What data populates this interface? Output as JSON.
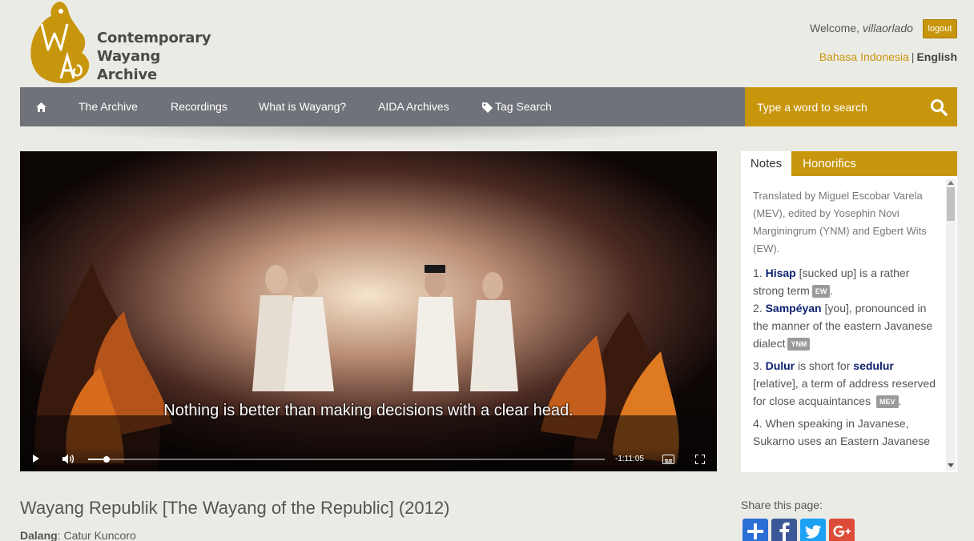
{
  "header": {
    "logo_lines": [
      "Contemporary",
      "Wayang",
      "Archive"
    ],
    "welcome_prefix": "Welcome, ",
    "username": "villaorlado",
    "logout_label": "logout",
    "lang_indonesian": "Bahasa Indonesia",
    "lang_separator": "|",
    "lang_english": "English"
  },
  "nav": {
    "home_icon": "home-icon",
    "items": [
      {
        "label": "The Archive"
      },
      {
        "label": "Recordings"
      },
      {
        "label": "What is Wayang?"
      },
      {
        "label": "AIDA Archives"
      },
      {
        "label": "Tag Search",
        "icon": "tag-icon"
      }
    ],
    "search_placeholder": "Type a word to search",
    "search_icon": "search-icon"
  },
  "video": {
    "subtitle": "Nothing is better than making decisions with a clear head.",
    "time_remaining": "-1:11:05",
    "progress_fraction": 0.035
  },
  "notes_panel": {
    "tabs": [
      {
        "label": "Notes",
        "active": true
      },
      {
        "label": "Honorifics",
        "active": false
      }
    ],
    "intro": "Translated by Miguel Escobar Varela (MEV), edited by Yosephin Novi Marginingrum (YNM) and Egbert Wits (EW).",
    "notes": [
      {
        "num": "1.",
        "term": "Hisap",
        "text": " [sucked up] is a rather strong term",
        "badge": "EW",
        "end": "."
      },
      {
        "num": "2.",
        "term": "Sampéyan",
        "text": " [you], pronounced in the manner of the eastern Javanese dialect",
        "badge": "YNM",
        "end": ""
      },
      {
        "num": "3.",
        "term": "Dulur",
        "text_a": " is short for ",
        "term2": "sedulur",
        "text": " [relative], a term of address reserved for close acquaintances",
        "badge": "MEV",
        "end": "."
      },
      {
        "num": "4.",
        "text": "When speaking in Javanese, Sukarno uses an Eastern Javanese"
      }
    ]
  },
  "recording": {
    "title": "Wayang Republik [The Wayang of the Republic] (2012)",
    "dalang_label": "Dalang",
    "dalang_value": ": Catur Kuncoro"
  },
  "share": {
    "label": "Share this page:",
    "buttons": [
      {
        "name": "share-addthis-icon",
        "color": "#2b6fd6"
      },
      {
        "name": "facebook-icon",
        "color": "#3b5998"
      },
      {
        "name": "twitter-icon",
        "color": "#1da1f2"
      },
      {
        "name": "google-plus-icon",
        "color": "#dd4b39"
      }
    ]
  },
  "colors": {
    "accent": "#c8960c",
    "nav_bg": "#70727a",
    "page_bg": "#ebebe6",
    "note_term": "#0b1f6e"
  }
}
